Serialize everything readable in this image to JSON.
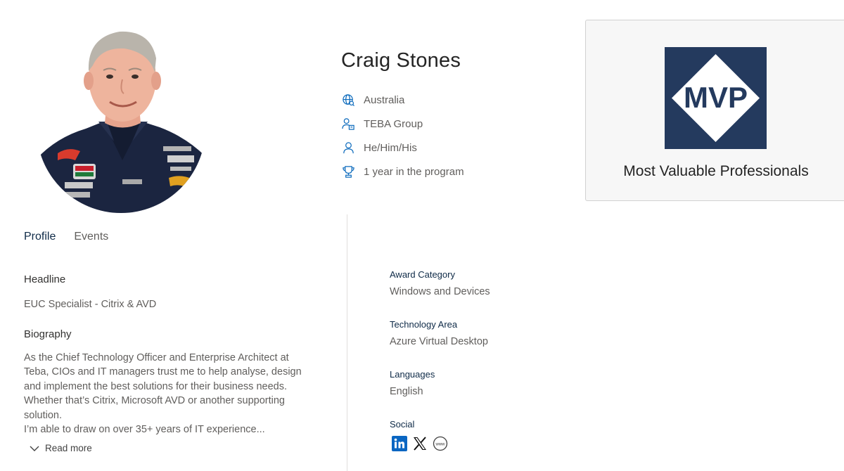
{
  "profile": {
    "name": "Craig Stones",
    "meta": {
      "location": "Australia",
      "company": "TEBA Group",
      "pronouns": "He/Him/His",
      "tenure": "1 year in the program"
    }
  },
  "mvp_card": {
    "logo_text": "MVP",
    "caption": "Most Valuable Professionals",
    "logo_color": "#243a5e"
  },
  "tabs": [
    {
      "label": "Profile",
      "active": true
    },
    {
      "label": "Events",
      "active": false
    }
  ],
  "details": {
    "headline_label": "Headline",
    "headline_value": "EUC Specialist - Citrix & AVD",
    "biography_label": "Biography",
    "biography_lines": [
      "As the Chief Technology Officer and Enterprise Architect at",
      "Teba, CIOs and IT managers trust me to help analyse, design",
      "and implement the best solutions for their business needs.",
      "Whether that’s Citrix, Microsoft AVD or another supporting",
      "solution.",
      "I’m able to draw on over 35+ years of IT experience..."
    ],
    "read_more": "Read more"
  },
  "award": {
    "category_label": "Award Category",
    "category_value": "Windows and Devices",
    "tech_label": "Technology Area",
    "tech_value": "Azure Virtual Desktop",
    "languages_label": "Languages",
    "languages_value": "English",
    "social_label": "Social",
    "social_icons": [
      "linkedin-icon",
      "x-icon",
      "website-icon"
    ]
  },
  "colors": {
    "accent": "#0f6cbd",
    "dark_navy": "#0e2a47",
    "linkedin": "#0a66c2"
  }
}
